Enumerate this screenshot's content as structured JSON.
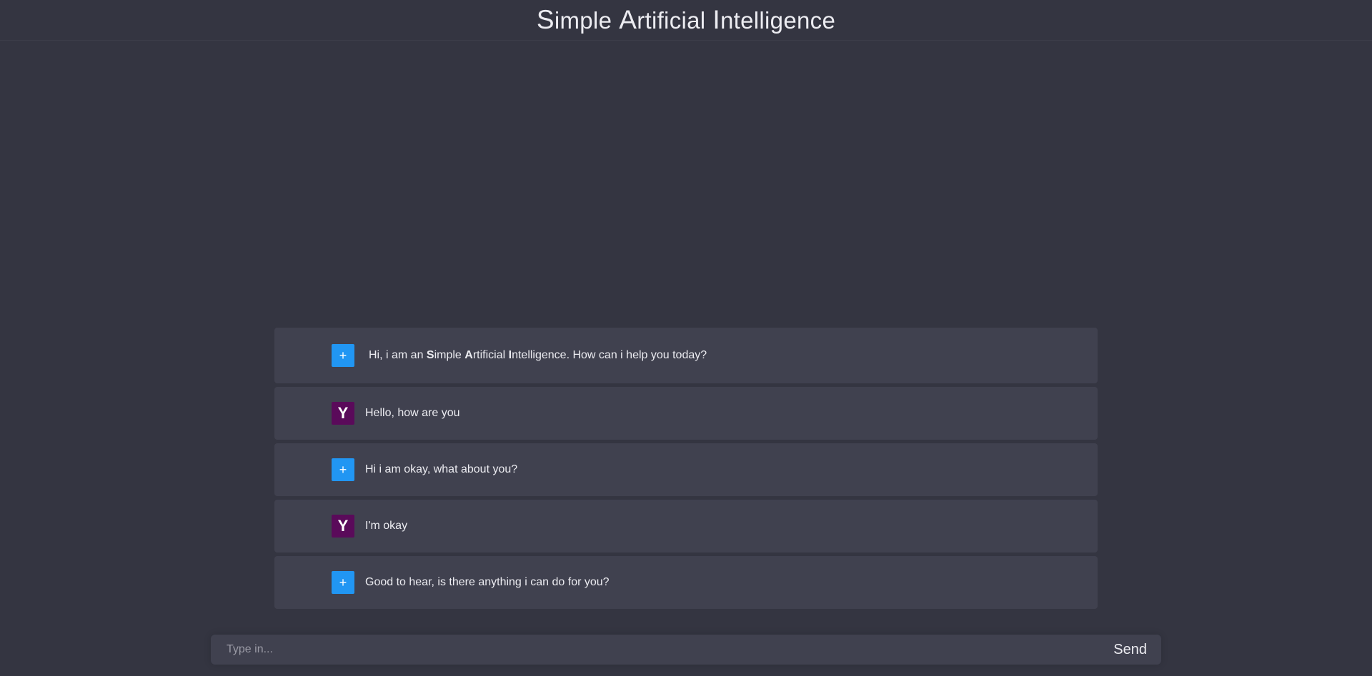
{
  "header": {
    "title_parts": [
      {
        "initial": "S",
        "rest": "imple"
      },
      {
        "initial": "A",
        "rest": "rtificial"
      },
      {
        "initial": "I",
        "rest": "ntelligence"
      }
    ]
  },
  "messages": [
    {
      "sender": "ai",
      "avatar": "+",
      "intro_before": "Hi, i am an ",
      "intro_parts": [
        {
          "initial": "S",
          "rest": "imple "
        },
        {
          "initial": "A",
          "rest": "rtificial "
        },
        {
          "initial": "I",
          "rest": "ntelligence"
        }
      ],
      "intro_after": ". How can i help you today?"
    },
    {
      "sender": "user",
      "avatar": "Y",
      "text": "Hello, how are you"
    },
    {
      "sender": "ai",
      "avatar": "+",
      "text": "Hi i am okay, what about you?"
    },
    {
      "sender": "user",
      "avatar": "Y",
      "text": "I'm okay"
    },
    {
      "sender": "ai",
      "avatar": "+",
      "text": "Good to hear, is there anything i can do for you?"
    }
  ],
  "input": {
    "placeholder": "Type in...",
    "value": "",
    "send_label": "Send"
  },
  "colors": {
    "background": "#343541",
    "message_bg": "#40414f",
    "ai_avatar": "#2196f3",
    "user_avatar": "#5a0a5a"
  }
}
